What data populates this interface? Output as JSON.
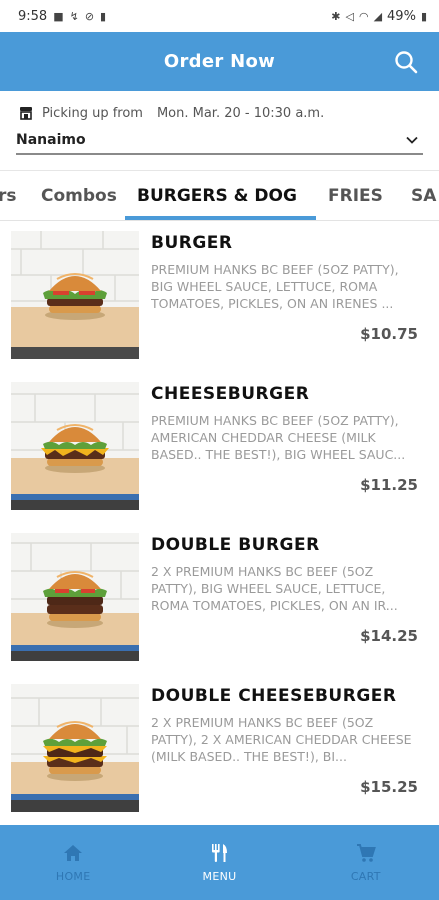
{
  "status_bar": {
    "time": "9:58",
    "battery": "49%"
  },
  "header": {
    "title": "Order Now"
  },
  "pickup": {
    "label": "Picking up from",
    "datetime": "Mon. Mar. 20 - 10:30 a.m.",
    "location": "Nanaimo"
  },
  "tabs": [
    {
      "label": "rs"
    },
    {
      "label": "Combos"
    },
    {
      "label": "BURGERS & DOG"
    },
    {
      "label": "FRIES"
    },
    {
      "label": "SA"
    }
  ],
  "items": [
    {
      "name": "BURGER",
      "description": "PREMIUM HANKS BC BEEF (5oz PATTY), BIG WHEEL SAUCE, LETTUCE, ROMA TOMATOES, PICKLES, ON AN IRENES ...",
      "price": "$10.75"
    },
    {
      "name": "CHEESEBURGER",
      "description": "PREMIUM HANKS BC BEEF (5oz PATTY), AMERICAN CHEDDAR CHEESE (MILK BASED.. THE BEST!), BIG WHEEL SAUC...",
      "price": "$11.25"
    },
    {
      "name": "DOUBLE BURGER",
      "description": "2 X PREMIUM HANKS BC BEEF (5oz PATTY), BIG WHEEL SAUCE, LETTUCE, ROMA TOMATOES, PICKLES, ON AN IR...",
      "price": "$14.25"
    },
    {
      "name": "DOUBLE CHEESEBURGER",
      "description": "2 X PREMIUM HANKS BC BEEF (5oz PATTY), 2 X AMERICAN CHEDDAR CHEESE (MILK BASED.. THE BEST!), BI...",
      "price": "$15.25"
    }
  ],
  "bottom_nav": [
    {
      "label": "HOME",
      "icon": "home-icon"
    },
    {
      "label": "MENU",
      "icon": "fork-knife-icon"
    },
    {
      "label": "CART",
      "icon": "cart-icon"
    }
  ],
  "colors": {
    "brand": "#4a9ad8",
    "nav_inactive": "#2f77b4"
  }
}
